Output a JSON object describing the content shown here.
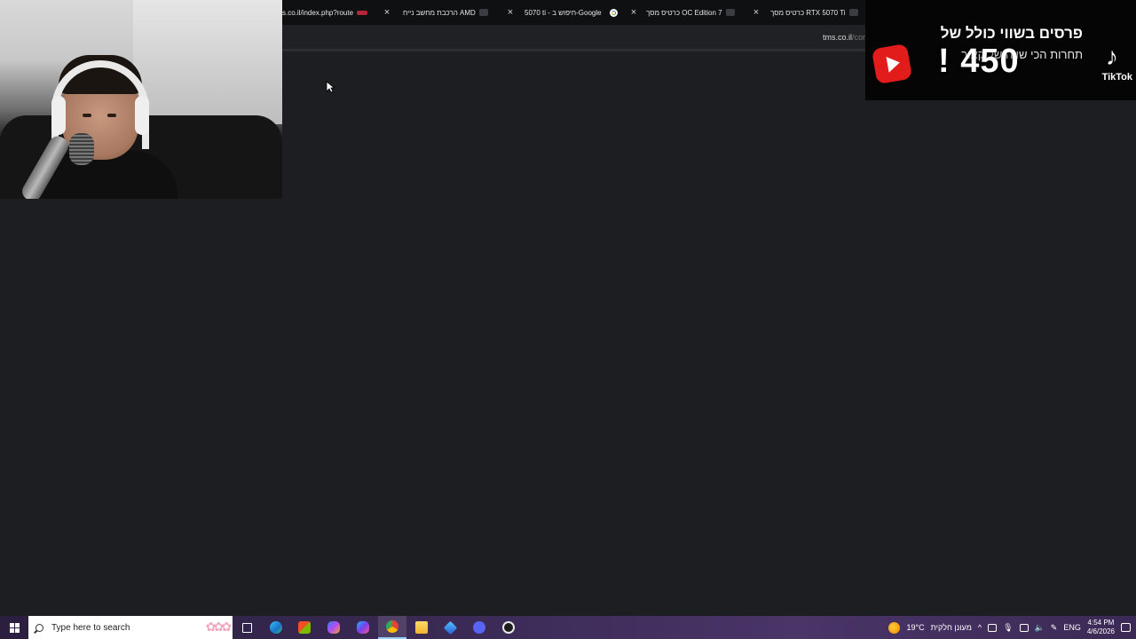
{
  "browser": {
    "tabs": [
      {
        "title": "s.co.il/index.php?route",
        "close": "×"
      },
      {
        "title": "הרכבת מחשב נייח AMD",
        "close": "×"
      },
      {
        "title": "5070 ti - חיפוש ב-Google",
        "close": "×"
      },
      {
        "title": "כרטיס מסך OC Edition 7",
        "close": "×"
      },
      {
        "title": "כרטיס מסך RTX 5070 Ti",
        "close": ""
      }
    ],
    "url_host": "tms.co.il",
    "url_path": "/cor"
  },
  "promo": {
    "line1": "פרסים בשווי כולל של",
    "line2": "תחרות הכי שווה של קאור",
    "price": "! 450",
    "tiktok_label": "TikTok",
    "tiktok_icon": "tiktok-icon",
    "youtube_icon": "youtube-shorts-icon"
  },
  "taskbar": {
    "search_placeholder": "Type here to search",
    "apps": [
      "task-view-icon",
      "edge-icon",
      "store-icon",
      "copilot-icon",
      "m365-icon",
      "chrome-icon",
      "file-explorer-icon",
      "app-icon",
      "discord-icon",
      "obs-icon"
    ],
    "weather_temp": "19°C",
    "weather_desc": "מעונן חלקית",
    "language": "ENG",
    "time": "4:54 PM",
    "date": "4/6/2026"
  },
  "colors": {
    "page_bg": "#1c1e21",
    "tab_strip": "#0f1012",
    "taskbar_accent": "#3a2a55"
  }
}
